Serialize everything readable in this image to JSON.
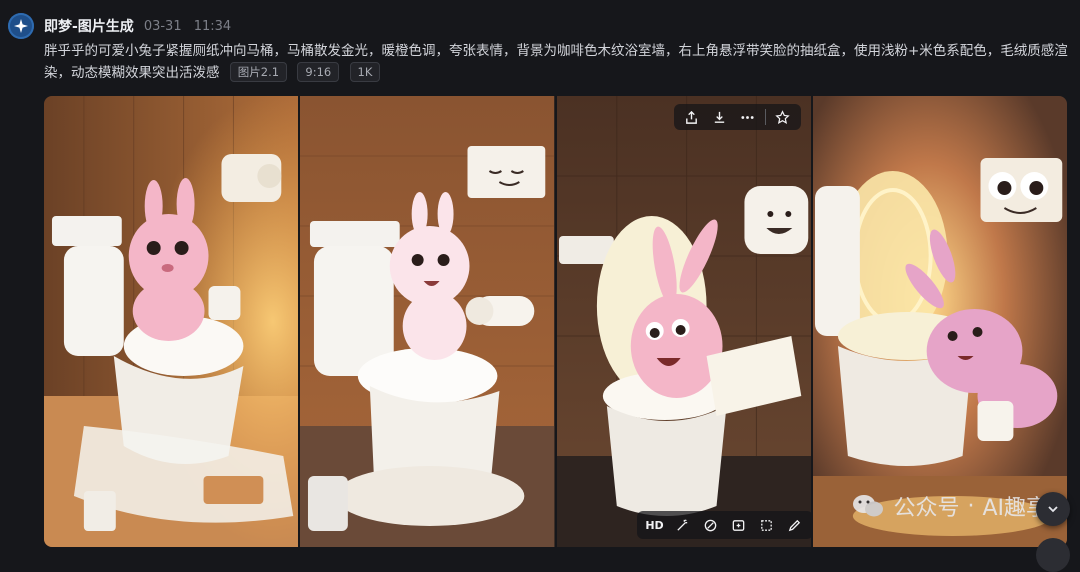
{
  "header": {
    "app_name": "即梦-图片生成",
    "date": "03-31",
    "time": "11:34",
    "logo_icon": "star-logo-icon"
  },
  "prompt": {
    "text": "胖乎乎的可爱小兔子紧握厕纸冲向马桶，马桶散发金光，暖橙色调，夸张表情，背景为咖啡色木纹浴室墙，右上角悬浮带笑脸的抽纸盒，使用浅粉+米色系配色，毛绒质感渲染，动态模糊效果突出活泼感",
    "tags": [
      "图片2.1",
      "9:16",
      "1K"
    ]
  },
  "gallery": {
    "images": [
      {
        "subject": "pink bunny beside toilet holding paper roll"
      },
      {
        "subject": "white bunny on toilet holding paper roll"
      },
      {
        "subject": "bunny with toilet paper by toilet"
      },
      {
        "subject": "bunny leaping into glowing toilet"
      }
    ],
    "top_toolbar": [
      "share-icon",
      "download-icon",
      "more-icon",
      "star-icon"
    ],
    "bottom_toolbar": {
      "hd_label": "HD",
      "icons": [
        "magic-wand-icon",
        "eraser-icon",
        "expand-icon",
        "crop-icon",
        "edit-icon"
      ]
    }
  },
  "watermark": {
    "channel": "公众号",
    "separator": "·",
    "name": "AI趣享"
  },
  "colors": {
    "background": "#16171b",
    "accent_blue": "#2e6bb0",
    "wall_warm": "#8a5a36",
    "bunny_pink": "#f4b6c8"
  }
}
